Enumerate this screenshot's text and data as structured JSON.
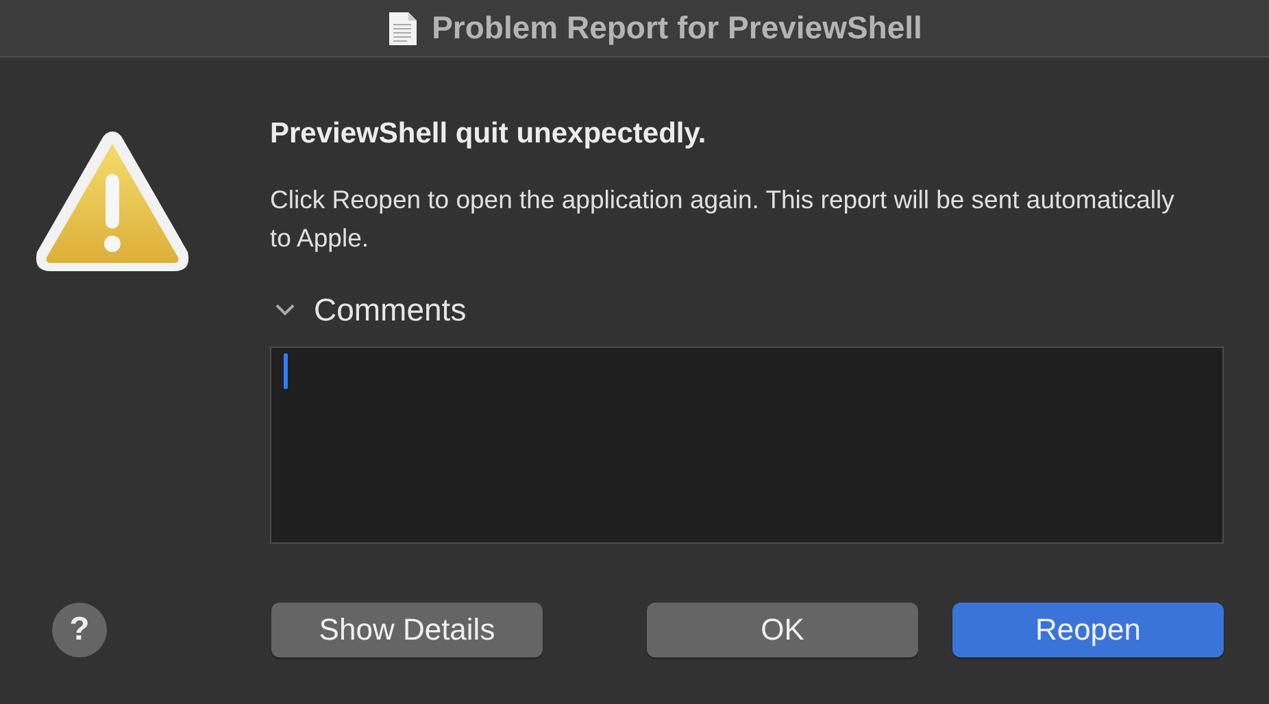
{
  "window": {
    "title": "Problem Report for PreviewShell"
  },
  "heading": "PreviewShell quit unexpectedly.",
  "message": "Click Reopen to open the application again. This report will be sent automatically to Apple.",
  "comments": {
    "label": "Comments",
    "expanded": true
  },
  "help_button": "?",
  "buttons": [
    {
      "label": "Show Details",
      "kind": "secondary"
    },
    {
      "label": "OK",
      "kind": "normal"
    },
    {
      "label": "Reopen",
      "kind": "default"
    }
  ]
}
